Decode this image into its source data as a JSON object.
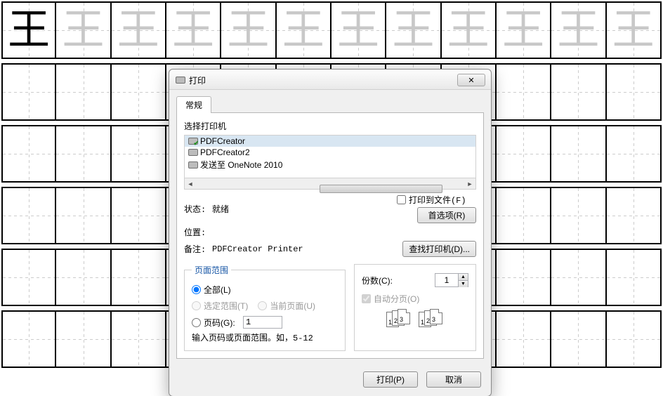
{
  "sheet": {
    "glyph": "王",
    "faint_count": 11
  },
  "dialog": {
    "title": "打印",
    "tab_general": "常规",
    "select_printer": "选择打印机",
    "printers": [
      {
        "name": "PDFCreator",
        "selected": true,
        "ok": true
      },
      {
        "name": "PDFCreator2",
        "selected": false,
        "ok": false
      },
      {
        "name": "发送至 OneNote 2010",
        "selected": false,
        "ok": false
      }
    ],
    "status_label": "状态:",
    "status_value": "就绪",
    "print_to_file": "打印到文件(F)",
    "preferences_btn": "首选项(R)",
    "location_label": "位置:",
    "comment_label": "备注:",
    "comment_value": "PDFCreator Printer",
    "find_printer_btn": "查找打印机(D)...",
    "range": {
      "legend": "页面范围",
      "all": "全部(L)",
      "selection": "选定范围(T)",
      "current": "当前页面(U)",
      "pages": "页码(G):",
      "pages_value": "1",
      "hint": "输入页码或页面范围。如，5-12"
    },
    "copies": {
      "label": "份数(C):",
      "value": "1",
      "collate": "自动分页(O)"
    },
    "print_btn": "打印(P)",
    "cancel_btn": "取消"
  }
}
